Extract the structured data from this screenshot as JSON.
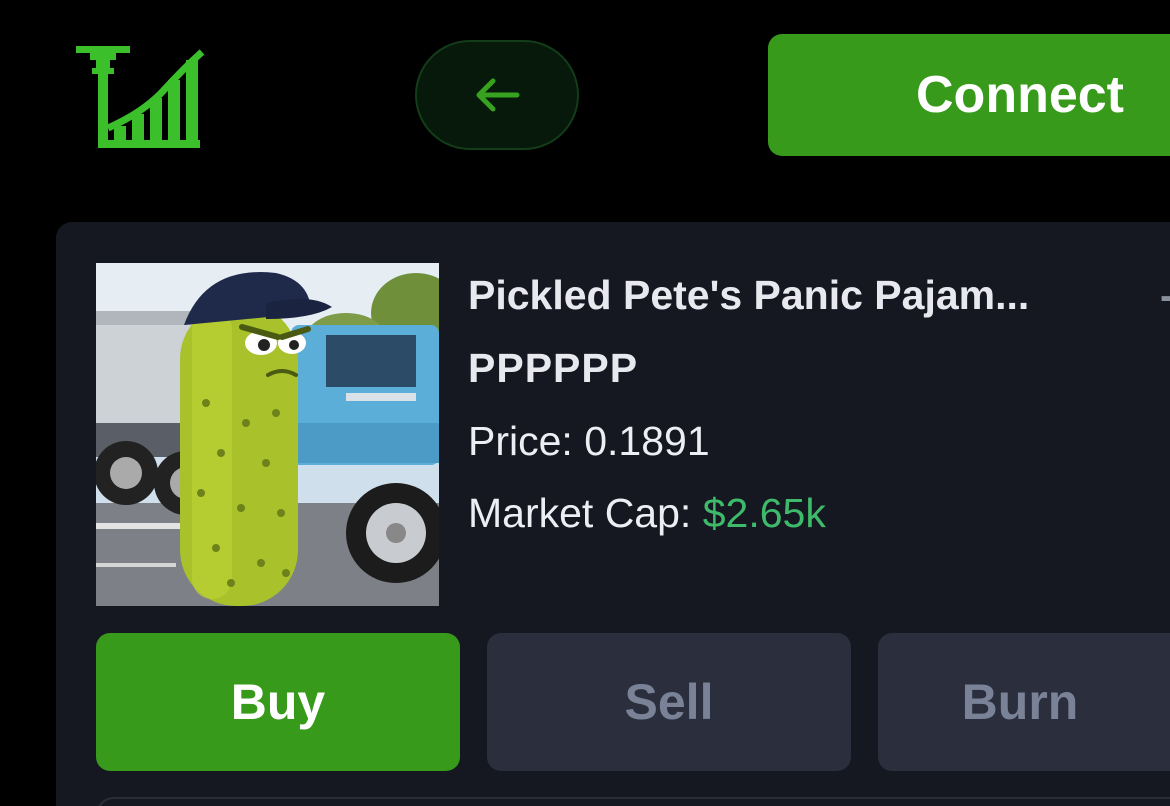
{
  "header": {
    "logo_icon": "tower-growth-chart-logo",
    "back_icon": "arrow-left-icon",
    "connect_label": "Connect"
  },
  "token": {
    "name": "Pickled Pete's Panic Pajam...",
    "symbol": "PPPPPP",
    "price_label": "Price:",
    "price_value": "0.1891",
    "market_cap_label": "Market Cap:",
    "market_cap_value": "$2.65k",
    "image": "pickle-character-with-cap-in-front-of-blue-truck"
  },
  "actions": {
    "buy_label": "Buy",
    "sell_label": "Sell",
    "burn_label": "Burn"
  },
  "colors": {
    "accent_green": "#379a1b",
    "market_cap_green": "#3dbb6a",
    "card_background": "#161821",
    "inactive_tab": "#2b2e3c"
  }
}
